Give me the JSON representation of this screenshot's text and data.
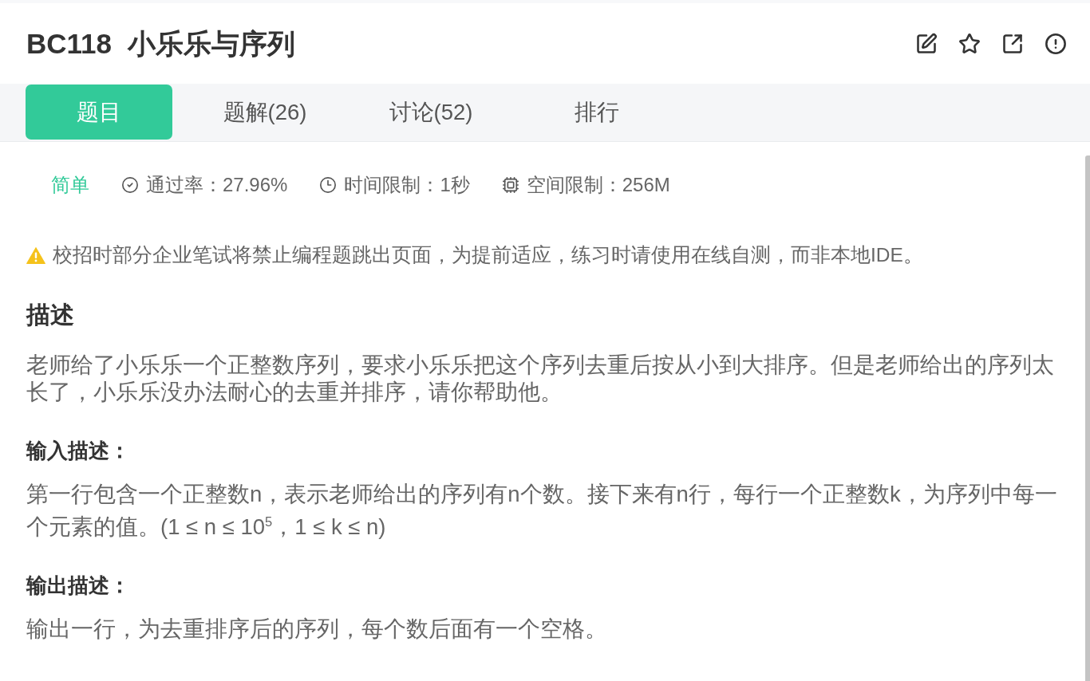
{
  "problem": {
    "id": "BC118",
    "title": "小乐乐与序列"
  },
  "tabs": [
    {
      "label": "题目",
      "selected": true
    },
    {
      "label": "题解(26)",
      "selected": false
    },
    {
      "label": "讨论(52)",
      "selected": false
    },
    {
      "label": "排行",
      "selected": false
    }
  ],
  "meta": {
    "difficulty": "简单",
    "stats": [
      {
        "kind": "pass_rate",
        "text": "通过率：27.96%"
      },
      {
        "kind": "time_limit",
        "text": "时间限制：1秒"
      },
      {
        "kind": "memory_limit",
        "text": "空间限制：256M"
      }
    ]
  },
  "notice": "校招时部分企业笔试将禁止编程题跳出页面，为提前适应，练习时请使用在线自测，而非本地IDE。",
  "sections": [
    {
      "kind": "main",
      "heading": "描述",
      "body": "老师给了小乐乐一个正整数序列，要求小乐乐把这个序列去重后按从小到大排序。但是老师给出的序列太长了，小乐乐没办法耐心的去重并排序，请你帮助他。"
    },
    {
      "kind": "sub",
      "heading": "输入描述：",
      "body": "第一行包含一个正整数n，表示老师给出的序列有n个数。接下来有n行，每行一个正整数k，为序列中每一个元素的值。(1 ≤ n ≤ 10$^{5}$，1 ≤ k ≤ n)"
    },
    {
      "kind": "sub",
      "heading": "输出描述：",
      "body": "输出一行，为去重排序后的序列，每个数后面有一个空格。"
    }
  ]
}
